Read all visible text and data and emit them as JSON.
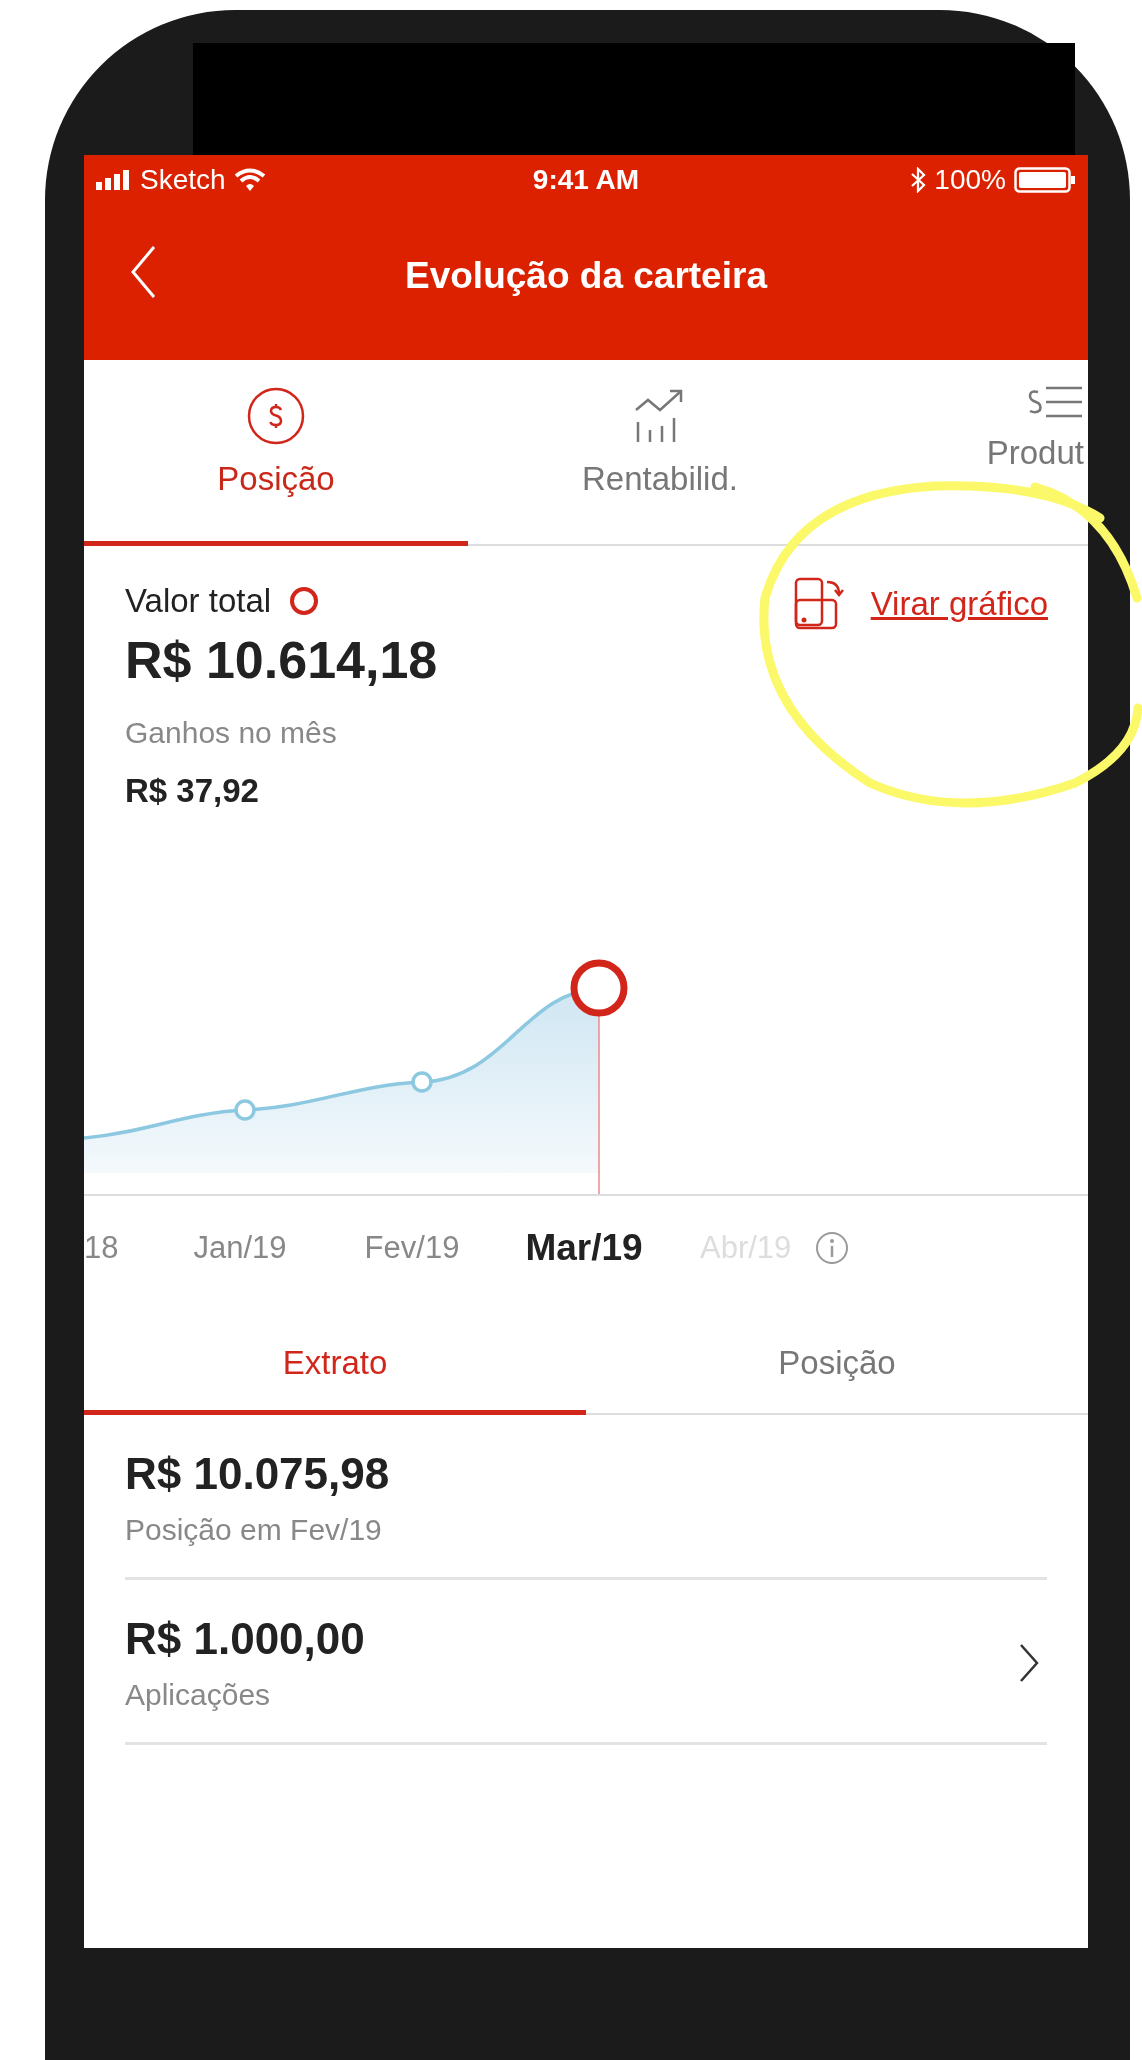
{
  "status_bar": {
    "carrier": "Sketch",
    "time": "9:41 AM",
    "battery": "100%"
  },
  "header": {
    "title": "Evolução da carteira"
  },
  "tabs": [
    {
      "label": "Posição",
      "selected": true,
      "kind": "dollar"
    },
    {
      "label": "Rentabilid.",
      "selected": false,
      "kind": "chart"
    },
    {
      "label": "Produt",
      "selected": false,
      "kind": "list"
    }
  ],
  "summary": {
    "label": "Valor total",
    "value": "R$ 10.614,18",
    "gains_label": "Ganhos no mês",
    "gains_value": "R$ 37,92",
    "flip_link": "Virar gráfico"
  },
  "months": [
    {
      "label": "18",
      "selected": false,
      "disabled": false
    },
    {
      "label": "Jan/19",
      "selected": false,
      "disabled": false
    },
    {
      "label": "Fev/19",
      "selected": false,
      "disabled": false
    },
    {
      "label": "Mar/19",
      "selected": true,
      "disabled": false
    },
    {
      "label": "Abr/19",
      "selected": false,
      "disabled": true
    }
  ],
  "subtabs": [
    {
      "label": "Extrato",
      "selected": true
    },
    {
      "label": "Posição",
      "selected": false
    }
  ],
  "entries": [
    {
      "value": "R$ 10.075,98",
      "label": "Posição em Fev/19",
      "chevron": false
    },
    {
      "value": "R$ 1.000,00",
      "label": "Aplicações",
      "chevron": true
    }
  ],
  "annotation": {
    "kind": "circle"
  }
}
